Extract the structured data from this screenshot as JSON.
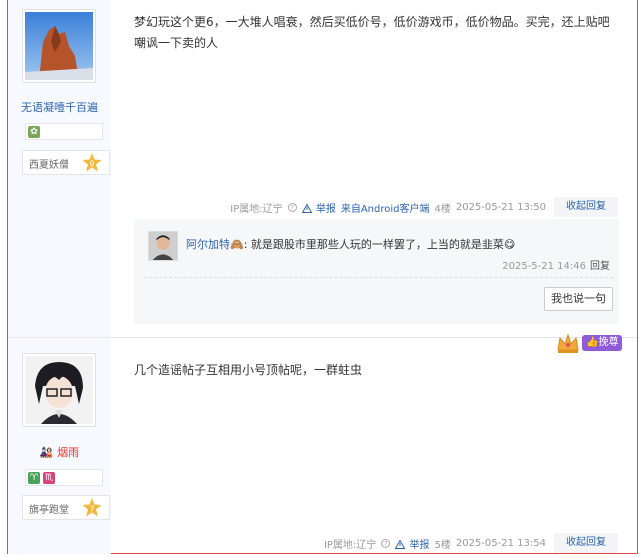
{
  "posts": [
    {
      "username": "无语凝噎千百遍",
      "level_name": "西夏妖僧",
      "level": "9",
      "content": "梦幻玩这个更6，一大堆人唱衰，然后买低价号，低价游戏币，低价物品。买完，还上贴吧嘲讽一下卖的人",
      "ip": "IP属地:辽宁",
      "report": "举报",
      "client": "来自Android客户端",
      "floor": "4楼",
      "time": "2025-05-21 13:50",
      "reply_label": "收起回复",
      "sub_replies": [
        {
          "user": "阿尔加特",
          "text": ": 就是跟股市里那些人玩的一样罢了，上当的就是韭菜",
          "time": "2025-5-21 14:46",
          "reply": "回复"
        }
      ],
      "say_label": "我也说一句"
    },
    {
      "username": "烟雨",
      "level_name": "旗亭跑堂",
      "level": "7",
      "content": "几个造谣帖子互相用小号顶帖呢，一群蛀虫",
      "ip": "IP属地:辽宁",
      "report": "举报",
      "floor": "5楼",
      "time": "2025-05-21 13:54",
      "reply_label": "收起回复",
      "badge": "挽尊"
    }
  ],
  "icons": {
    "help": "?",
    "sign_icon_1": "♈",
    "sign_icon_2": "♏"
  }
}
